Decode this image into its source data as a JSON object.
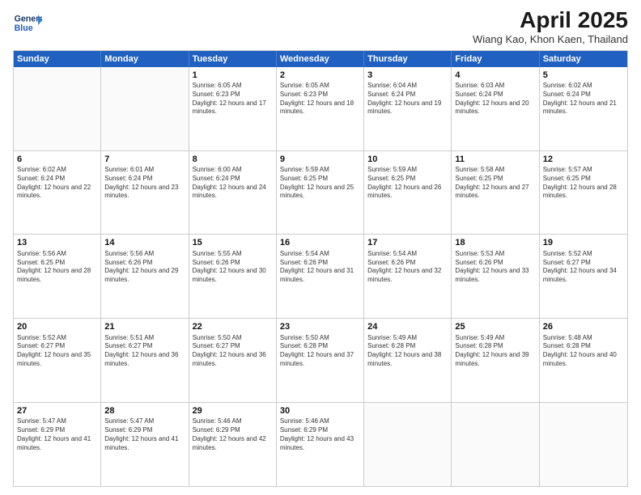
{
  "header": {
    "logo_line1": "General",
    "logo_line2": "Blue",
    "month_title": "April 2025",
    "subtitle": "Wiang Kao, Khon Kaen, Thailand"
  },
  "days_of_week": [
    "Sunday",
    "Monday",
    "Tuesday",
    "Wednesday",
    "Thursday",
    "Friday",
    "Saturday"
  ],
  "weeks": [
    [
      {
        "day": "",
        "sunrise": "",
        "sunset": "",
        "daylight": ""
      },
      {
        "day": "",
        "sunrise": "",
        "sunset": "",
        "daylight": ""
      },
      {
        "day": "1",
        "sunrise": "Sunrise: 6:05 AM",
        "sunset": "Sunset: 6:23 PM",
        "daylight": "Daylight: 12 hours and 17 minutes."
      },
      {
        "day": "2",
        "sunrise": "Sunrise: 6:05 AM",
        "sunset": "Sunset: 6:23 PM",
        "daylight": "Daylight: 12 hours and 18 minutes."
      },
      {
        "day": "3",
        "sunrise": "Sunrise: 6:04 AM",
        "sunset": "Sunset: 6:24 PM",
        "daylight": "Daylight: 12 hours and 19 minutes."
      },
      {
        "day": "4",
        "sunrise": "Sunrise: 6:03 AM",
        "sunset": "Sunset: 6:24 PM",
        "daylight": "Daylight: 12 hours and 20 minutes."
      },
      {
        "day": "5",
        "sunrise": "Sunrise: 6:02 AM",
        "sunset": "Sunset: 6:24 PM",
        "daylight": "Daylight: 12 hours and 21 minutes."
      }
    ],
    [
      {
        "day": "6",
        "sunrise": "Sunrise: 6:02 AM",
        "sunset": "Sunset: 6:24 PM",
        "daylight": "Daylight: 12 hours and 22 minutes."
      },
      {
        "day": "7",
        "sunrise": "Sunrise: 6:01 AM",
        "sunset": "Sunset: 6:24 PM",
        "daylight": "Daylight: 12 hours and 23 minutes."
      },
      {
        "day": "8",
        "sunrise": "Sunrise: 6:00 AM",
        "sunset": "Sunset: 6:24 PM",
        "daylight": "Daylight: 12 hours and 24 minutes."
      },
      {
        "day": "9",
        "sunrise": "Sunrise: 5:59 AM",
        "sunset": "Sunset: 6:25 PM",
        "daylight": "Daylight: 12 hours and 25 minutes."
      },
      {
        "day": "10",
        "sunrise": "Sunrise: 5:59 AM",
        "sunset": "Sunset: 6:25 PM",
        "daylight": "Daylight: 12 hours and 26 minutes."
      },
      {
        "day": "11",
        "sunrise": "Sunrise: 5:58 AM",
        "sunset": "Sunset: 6:25 PM",
        "daylight": "Daylight: 12 hours and 27 minutes."
      },
      {
        "day": "12",
        "sunrise": "Sunrise: 5:57 AM",
        "sunset": "Sunset: 6:25 PM",
        "daylight": "Daylight: 12 hours and 28 minutes."
      }
    ],
    [
      {
        "day": "13",
        "sunrise": "Sunrise: 5:56 AM",
        "sunset": "Sunset: 6:25 PM",
        "daylight": "Daylight: 12 hours and 28 minutes."
      },
      {
        "day": "14",
        "sunrise": "Sunrise: 5:56 AM",
        "sunset": "Sunset: 6:26 PM",
        "daylight": "Daylight: 12 hours and 29 minutes."
      },
      {
        "day": "15",
        "sunrise": "Sunrise: 5:55 AM",
        "sunset": "Sunset: 6:26 PM",
        "daylight": "Daylight: 12 hours and 30 minutes."
      },
      {
        "day": "16",
        "sunrise": "Sunrise: 5:54 AM",
        "sunset": "Sunset: 6:26 PM",
        "daylight": "Daylight: 12 hours and 31 minutes."
      },
      {
        "day": "17",
        "sunrise": "Sunrise: 5:54 AM",
        "sunset": "Sunset: 6:26 PM",
        "daylight": "Daylight: 12 hours and 32 minutes."
      },
      {
        "day": "18",
        "sunrise": "Sunrise: 5:53 AM",
        "sunset": "Sunset: 6:26 PM",
        "daylight": "Daylight: 12 hours and 33 minutes."
      },
      {
        "day": "19",
        "sunrise": "Sunrise: 5:52 AM",
        "sunset": "Sunset: 6:27 PM",
        "daylight": "Daylight: 12 hours and 34 minutes."
      }
    ],
    [
      {
        "day": "20",
        "sunrise": "Sunrise: 5:52 AM",
        "sunset": "Sunset: 6:27 PM",
        "daylight": "Daylight: 12 hours and 35 minutes."
      },
      {
        "day": "21",
        "sunrise": "Sunrise: 5:51 AM",
        "sunset": "Sunset: 6:27 PM",
        "daylight": "Daylight: 12 hours and 36 minutes."
      },
      {
        "day": "22",
        "sunrise": "Sunrise: 5:50 AM",
        "sunset": "Sunset: 6:27 PM",
        "daylight": "Daylight: 12 hours and 36 minutes."
      },
      {
        "day": "23",
        "sunrise": "Sunrise: 5:50 AM",
        "sunset": "Sunset: 6:28 PM",
        "daylight": "Daylight: 12 hours and 37 minutes."
      },
      {
        "day": "24",
        "sunrise": "Sunrise: 5:49 AM",
        "sunset": "Sunset: 6:28 PM",
        "daylight": "Daylight: 12 hours and 38 minutes."
      },
      {
        "day": "25",
        "sunrise": "Sunrise: 5:49 AM",
        "sunset": "Sunset: 6:28 PM",
        "daylight": "Daylight: 12 hours and 39 minutes."
      },
      {
        "day": "26",
        "sunrise": "Sunrise: 5:48 AM",
        "sunset": "Sunset: 6:28 PM",
        "daylight": "Daylight: 12 hours and 40 minutes."
      }
    ],
    [
      {
        "day": "27",
        "sunrise": "Sunrise: 5:47 AM",
        "sunset": "Sunset: 6:29 PM",
        "daylight": "Daylight: 12 hours and 41 minutes."
      },
      {
        "day": "28",
        "sunrise": "Sunrise: 5:47 AM",
        "sunset": "Sunset: 6:29 PM",
        "daylight": "Daylight: 12 hours and 41 minutes."
      },
      {
        "day": "29",
        "sunrise": "Sunrise: 5:46 AM",
        "sunset": "Sunset: 6:29 PM",
        "daylight": "Daylight: 12 hours and 42 minutes."
      },
      {
        "day": "30",
        "sunrise": "Sunrise: 5:46 AM",
        "sunset": "Sunset: 6:29 PM",
        "daylight": "Daylight: 12 hours and 43 minutes."
      },
      {
        "day": "",
        "sunrise": "",
        "sunset": "",
        "daylight": ""
      },
      {
        "day": "",
        "sunrise": "",
        "sunset": "",
        "daylight": ""
      },
      {
        "day": "",
        "sunrise": "",
        "sunset": "",
        "daylight": ""
      }
    ]
  ]
}
